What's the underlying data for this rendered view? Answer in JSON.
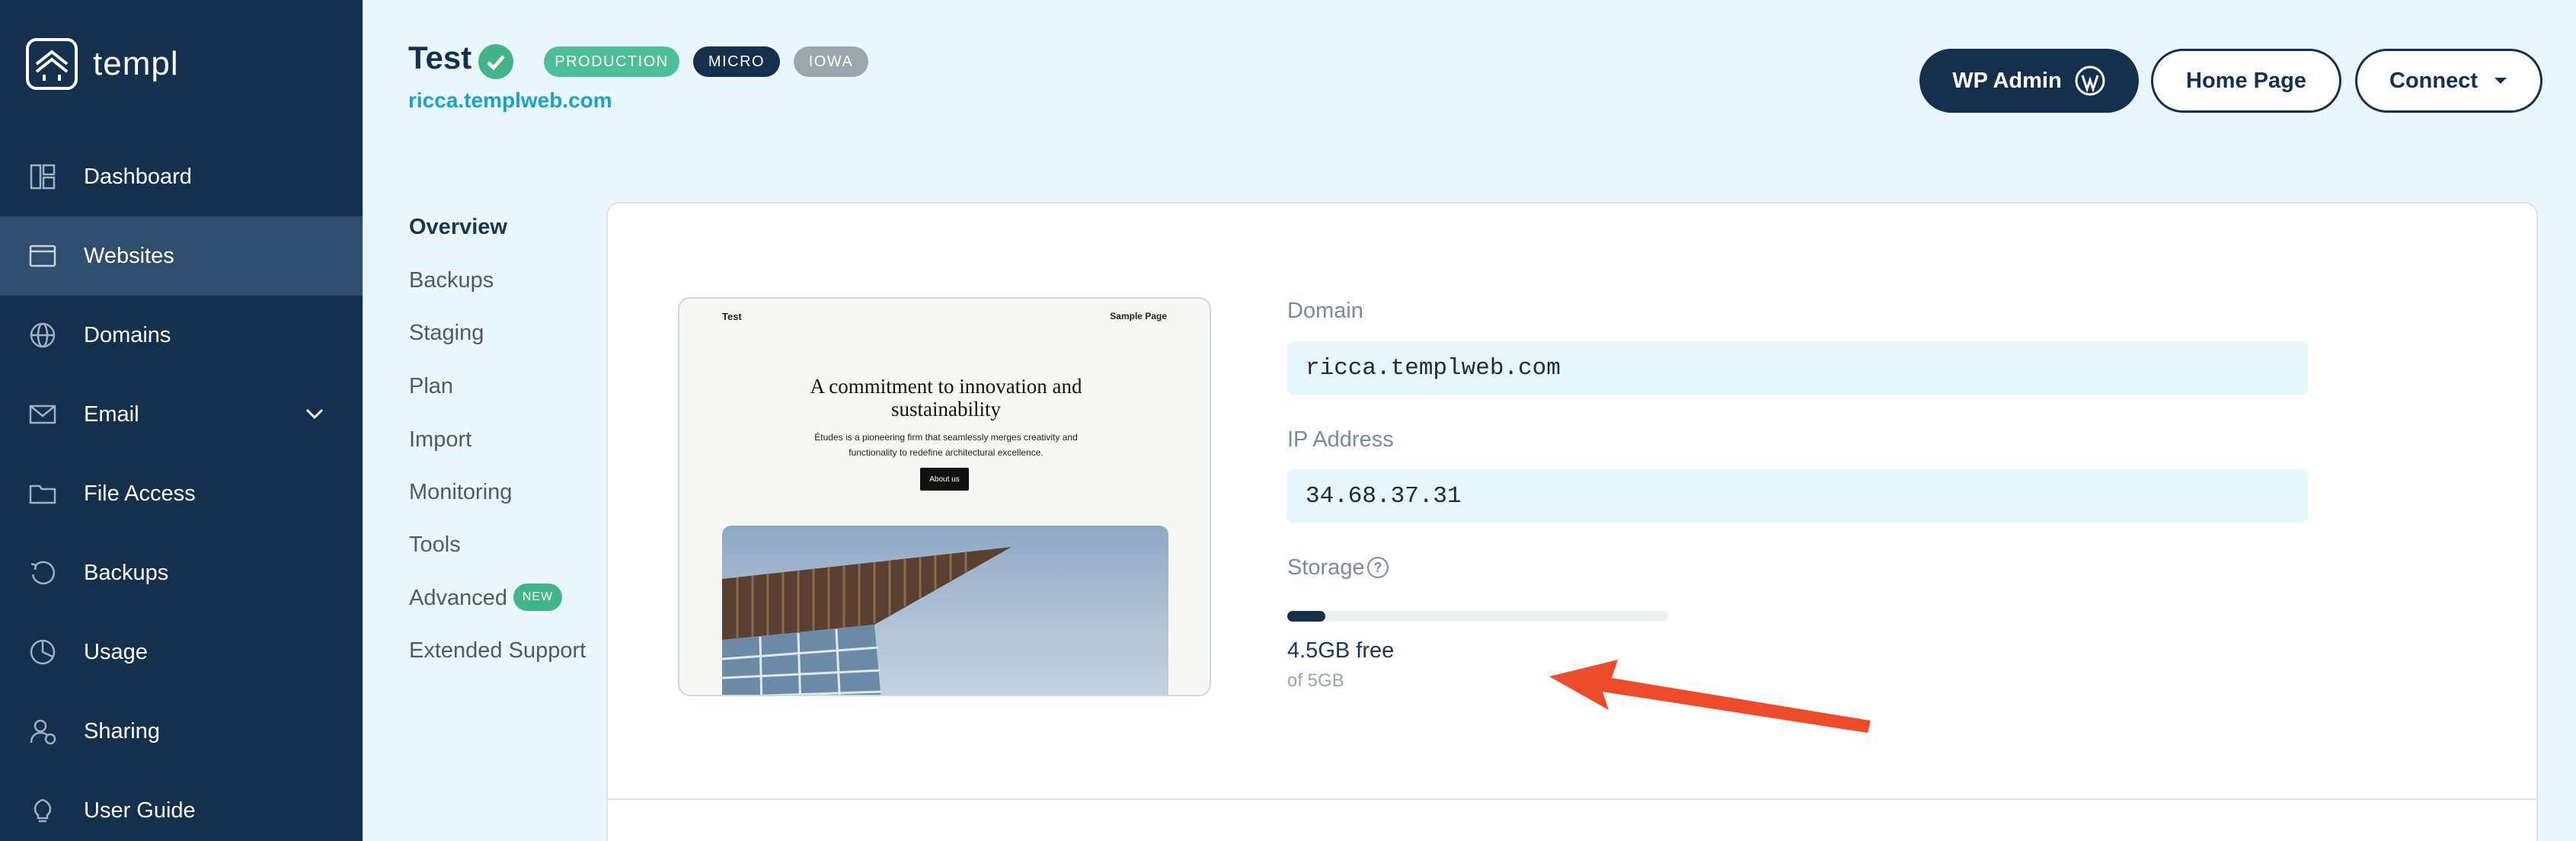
{
  "app": {
    "name": "templ"
  },
  "sidebar": {
    "items": [
      {
        "label": "Dashboard",
        "icon": "dashboard-icon"
      },
      {
        "label": "Websites",
        "icon": "browser-window-icon",
        "active": true
      },
      {
        "label": "Domains",
        "icon": "globe-icon"
      },
      {
        "label": "Email",
        "icon": "envelope-icon",
        "has_chevron": true
      },
      {
        "label": "File Access",
        "icon": "folder-icon"
      },
      {
        "label": "Backups",
        "icon": "backup-icon"
      },
      {
        "label": "Usage",
        "icon": "pie-chart-icon"
      },
      {
        "label": "Sharing",
        "icon": "user-share-icon"
      },
      {
        "label": "User Guide",
        "icon": "lightbulb-icon"
      }
    ]
  },
  "header": {
    "title": "Test",
    "status_icon": "check-circle-icon",
    "badges": [
      {
        "label": "PRODUCTION",
        "color": "#4dbf98"
      },
      {
        "label": "MICRO",
        "color": "#14304d"
      },
      {
        "label": "IOWA",
        "color": "#9aa6ad"
      }
    ],
    "subdomain": "ricca.templweb.com",
    "buttons": {
      "wp_admin": "WP Admin",
      "home_page": "Home Page",
      "connect": "Connect"
    }
  },
  "subnav": {
    "items": [
      {
        "label": "Overview",
        "active": true
      },
      {
        "label": "Backups"
      },
      {
        "label": "Staging"
      },
      {
        "label": "Plan"
      },
      {
        "label": "Import"
      },
      {
        "label": "Monitoring"
      },
      {
        "label": "Tools"
      },
      {
        "label": "Advanced",
        "badge": "NEW"
      },
      {
        "label": "Extended Support"
      }
    ]
  },
  "preview": {
    "site_title": "Test",
    "nav_link": "Sample Page",
    "heading": "A commitment to innovation and sustainability",
    "body": "Études is a pioneering firm that seamlessly merges creativity and functionality to redefine architectural excellence.",
    "button": "About us"
  },
  "overview": {
    "domain_label": "Domain",
    "domain_value": "ricca.templweb.com",
    "ip_label": "IP Address",
    "ip_value": "34.68.37.31",
    "storage_label": "Storage",
    "storage_used_fraction": 0.1,
    "storage_free": "4.5GB free",
    "storage_total": "of 5GB"
  },
  "colors": {
    "sidebar_bg": "#14304d",
    "accent_teal": "#1aa3c3",
    "success": "#43b48a",
    "annotation_arrow": "#ee4b2b"
  }
}
